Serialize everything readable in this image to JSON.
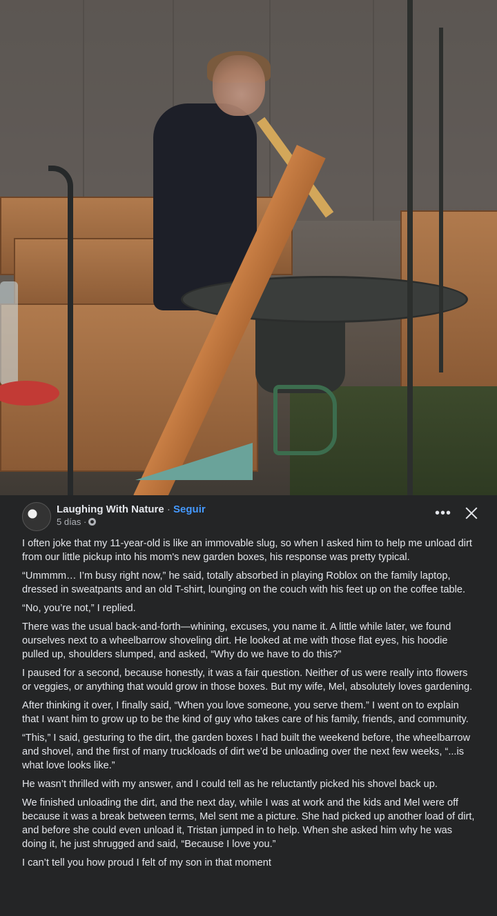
{
  "post": {
    "page_name": "Laughing With Nature",
    "separator": "·",
    "follow_label": "Seguir",
    "time": "5 días ·",
    "more_icon": "ellipsis-icon",
    "close_icon": "close-icon",
    "privacy_icon": "gear-icon",
    "paragraphs": [
      "I often joke that my 11-year-old is like an immovable slug, so when I asked him to help me unload dirt from our little pickup into his mom's new garden boxes, his response was pretty typical.",
      "“Ummmm… I’m busy right now,” he said, totally absorbed in playing Roblox on the family laptop, dressed in sweatpants and an old T-shirt, lounging on the couch with his feet up on the coffee table.",
      "“No, you’re not,” I replied.",
      "There was the usual back-and-forth—whining, excuses, you name it. A little while later, we found ourselves next to a wheelbarrow shoveling dirt. He looked at me with those flat eyes, his hoodie pulled up, shoulders slumped, and asked, “Why do we have to do this?”",
      "I paused for a second, because honestly, it was a fair question. Neither of us were really into flowers or veggies, or anything that would grow in those boxes. But my wife, Mel, absolutely loves gardening.",
      "After thinking it over, I finally said, “When you love someone, you serve them.” I went on to explain that I want him to grow up to be the kind of guy who takes care of his family, friends, and community.",
      "“This,” I said, gesturing to the dirt, the garden boxes I had built the weekend before, the wheelbarrow and shovel, and the first of many truckloads of dirt we’d be unloading over the next few weeks, “...is what love looks like.”",
      "He wasn’t thrilled with my answer, and I could tell as he reluctantly picked his shovel back up.",
      "We finished unloading the dirt, and the next day, while I was at work and the kids and Mel were off because it was a break between terms, Mel sent me a picture. She had picked up another load of dirt, and before she could even unload it, Tristan jumped in to help. When she asked him why he was doing it, he just shrugged and said, “Because I love you.”",
      "I can’t tell you how proud I felt of my son in that moment"
    ]
  }
}
